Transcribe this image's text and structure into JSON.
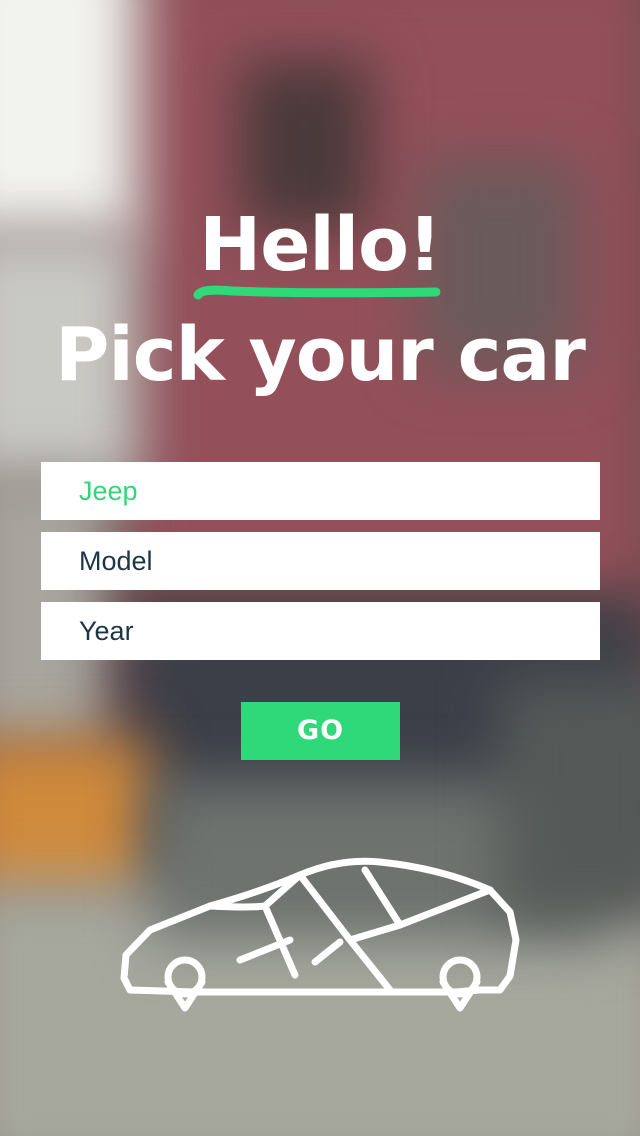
{
  "title": {
    "greeting": "Hello!",
    "subtitle": "Pick your car"
  },
  "form": {
    "make_value": "Jeep",
    "model_placeholder": "Model",
    "year_placeholder": "Year"
  },
  "go_button": {
    "label": "GO"
  },
  "colors": {
    "accent": "#2fd879",
    "field_text": "#1e3448"
  },
  "illustration": {
    "icon": "car-outline-icon"
  }
}
